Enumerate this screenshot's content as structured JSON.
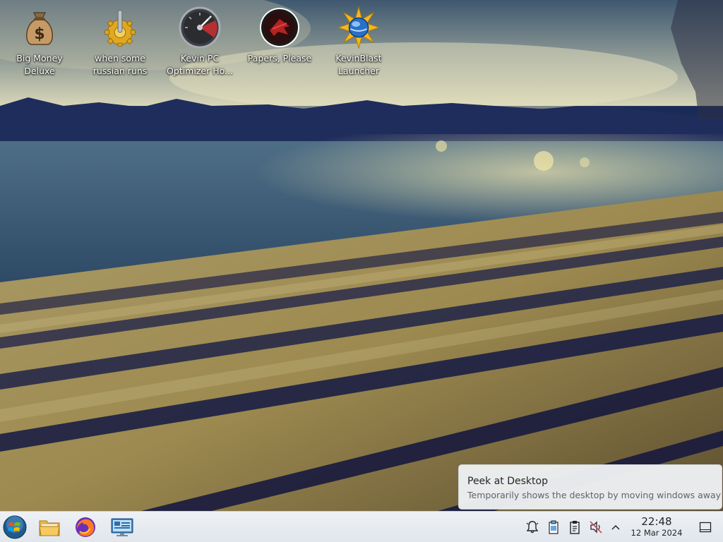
{
  "desktop": {
    "icons": [
      {
        "label": "Big Money Deluxe",
        "icon": "money-bag-icon"
      },
      {
        "label": "when some russian runs a...",
        "icon": "gear-lever-icon"
      },
      {
        "label": "Kevin PC Optimizer Ho...",
        "icon": "speedometer-icon"
      },
      {
        "label": "Papers, Please",
        "icon": "papers-please-emblem-icon"
      },
      {
        "label": "KevinBlast Launcher",
        "icon": "blast-globe-icon"
      }
    ]
  },
  "tooltip": {
    "title": "Peek at Desktop",
    "description": "Temporarily shows the desktop by moving windows away"
  },
  "taskbar": {
    "launchers": [
      {
        "name": "start-menu-button",
        "icon": "windows-orb-icon"
      },
      {
        "name": "file-manager-button",
        "icon": "folder-icon"
      },
      {
        "name": "firefox-button",
        "icon": "firefox-icon"
      },
      {
        "name": "system-settings-button",
        "icon": "monitor-settings-icon"
      }
    ],
    "tray": [
      {
        "name": "notifications-icon"
      },
      {
        "name": "clipboard-paste-icon"
      },
      {
        "name": "clipboard-icon"
      },
      {
        "name": "volume-muted-icon"
      },
      {
        "name": "expand-tray-icon"
      }
    ],
    "clock": {
      "time": "22:48",
      "date": "12 Mar 2024"
    },
    "show_desktop": "show-desktop-icon"
  },
  "colors": {
    "taskbar_bg": "#e4e8ee",
    "tooltip_bg": "#eef0f3",
    "icon_label": "#ffffff"
  }
}
